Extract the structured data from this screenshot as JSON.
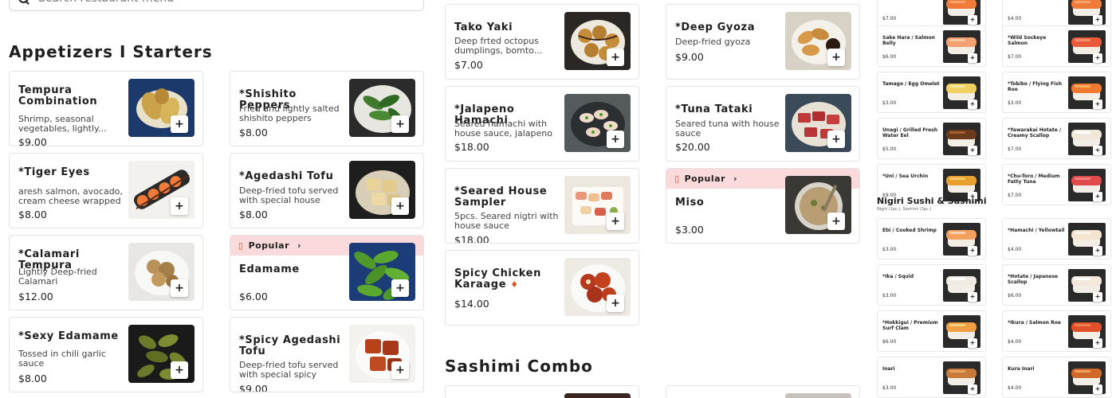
{
  "search": {
    "placeholder": "Search restaurant menu"
  },
  "sections": {
    "appetizers": "Appetizers I Starters",
    "sashimi_combo": "Sashimi Combo",
    "nigiri": {
      "title": "Nigiri Sushi & Sashimi",
      "subtitle": "Nigiri (1pc.), Sashimi (3pc.)"
    }
  },
  "add_glyph": "+",
  "popular_label": "Popular",
  "popular_icon": "fire-icon",
  "colors": {
    "popular_bg": "#fadadb",
    "accent": "#e0522a"
  },
  "col1": [
    {
      "name": "Tempura Combination",
      "desc": "Shrimp, seasonal vegetables, lightly...",
      "price": "$9.00"
    },
    {
      "name": "*Tiger Eyes",
      "desc": "aresh salmon, avocado, cream cheese wrapped ...",
      "price": "$8.00"
    },
    {
      "name": "*Calamari Tempura",
      "desc": "Lightly Deep-fried Calamari",
      "price": "$12.00"
    },
    {
      "name": "*Sexy Edamame",
      "desc": "Tossed in chili garlic sauce",
      "price": "$8.00"
    }
  ],
  "col2": [
    {
      "name": "*Shishito Peppers",
      "desc": "Fried and lightly salted shishito peppers",
      "price": "$8.00"
    },
    {
      "name": "*Agedashi Tofu",
      "desc": "Deep-fried tofu served with special house sauce",
      "price": "$8.00"
    },
    {
      "name": "Edamame",
      "desc": "",
      "price": "$6.00",
      "popular": true
    },
    {
      "name": "*Spicy Agedashi Tofu",
      "desc": "Deep-fried tofu served with special spicy sauce",
      "price": "$9.00"
    }
  ],
  "col3": [
    {
      "name": "Tako Yaki",
      "desc": "Deep frted octopus dumplings, bomto...",
      "price": "$7.00"
    },
    {
      "name": "*Jalapeno Hamachi",
      "desc": "Seared hamachi with house sauce, jalapeno ...",
      "price": "$18.00"
    },
    {
      "name": "*Seared House Sampler",
      "desc": "5pcs. Seared nigtri with house sauce",
      "price": "$18.00"
    },
    {
      "name": "Spicy Chicken Karaage",
      "desc": "",
      "price": "$14.00",
      "spicy": true
    }
  ],
  "col4": [
    {
      "name": "*Deep Gyoza",
      "desc": "Deep-fried gyoza",
      "price": "$9.00"
    },
    {
      "name": "*Tuna Tataki",
      "desc": "Seared tuna with house sauce",
      "price": "$20.00"
    },
    {
      "name": "Miso",
      "desc": "",
      "price": "$3.00",
      "popular": true
    }
  ],
  "small_left": [
    {
      "name": "",
      "price": "$7.00"
    },
    {
      "name": "Sake Hara / Salmon Belly",
      "price": "$6.00"
    },
    {
      "name": "Tamago / Egg Omelet",
      "price": "$3.00"
    },
    {
      "name": "Unagi / Grilled Fresh Water Eel",
      "price": "$5.00"
    },
    {
      "name": "*Uni / Sea Urchin",
      "price": "$9.00"
    },
    {
      "name": "Ebi / Cooked Shrimp",
      "price": "$3.00"
    },
    {
      "name": "*Ika / Squid",
      "price": "$3.00"
    },
    {
      "name": "*Hokkigui / Premium Surf Clam",
      "price": "$6.00"
    },
    {
      "name": "Inari",
      "price": "$3.00"
    }
  ],
  "small_right": [
    {
      "name": "",
      "price": "$4.00"
    },
    {
      "name": "*Wild Sockeye Salmon",
      "price": "$7.00"
    },
    {
      "name": "*Tobiko / Flying Fish Roe",
      "price": "$3.00"
    },
    {
      "name": "*Yawarakai Hotate / Creamy Scallop",
      "price": "$7.00"
    },
    {
      "name": "*Chu-Toro / Medium Fatty Tuna",
      "price": "$7.00"
    },
    {
      "name": "*Hamachi / Yellowtail",
      "price": "$4.00"
    },
    {
      "name": "*Hotate / Japanese Scallop",
      "price": "$6.00"
    },
    {
      "name": "*Ikura / Salmon Roe",
      "price": "$4.00"
    },
    {
      "name": "Kura Inari",
      "price": "$4.00"
    }
  ]
}
